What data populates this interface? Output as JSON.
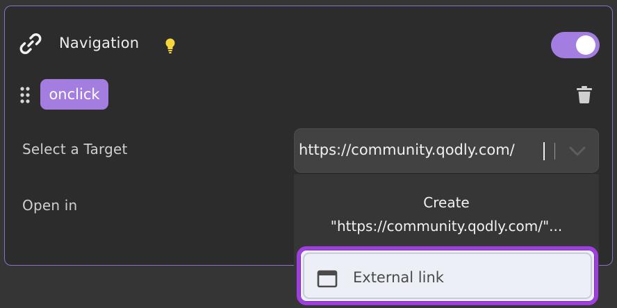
{
  "section": {
    "title": "Navigation",
    "link_icon": "link-icon",
    "hint_icon": "lightbulb-icon",
    "enabled": true
  },
  "event": {
    "drag_icon": "drag-handle-icon",
    "name": "onclick",
    "delete_icon": "trash-icon"
  },
  "fields": {
    "target_label": "Select a Target",
    "target_value": "https://community.qodly.com/",
    "open_in_label": "Open in"
  },
  "dropdown": {
    "create_line1": "Create",
    "create_line2": "\"https://community.qodly.com/\"...",
    "external_label": "External link",
    "external_icon": "window-icon"
  },
  "colors": {
    "accent": "#a47de0",
    "highlight": "#a03fe0",
    "bulb": "#f5d63b"
  }
}
